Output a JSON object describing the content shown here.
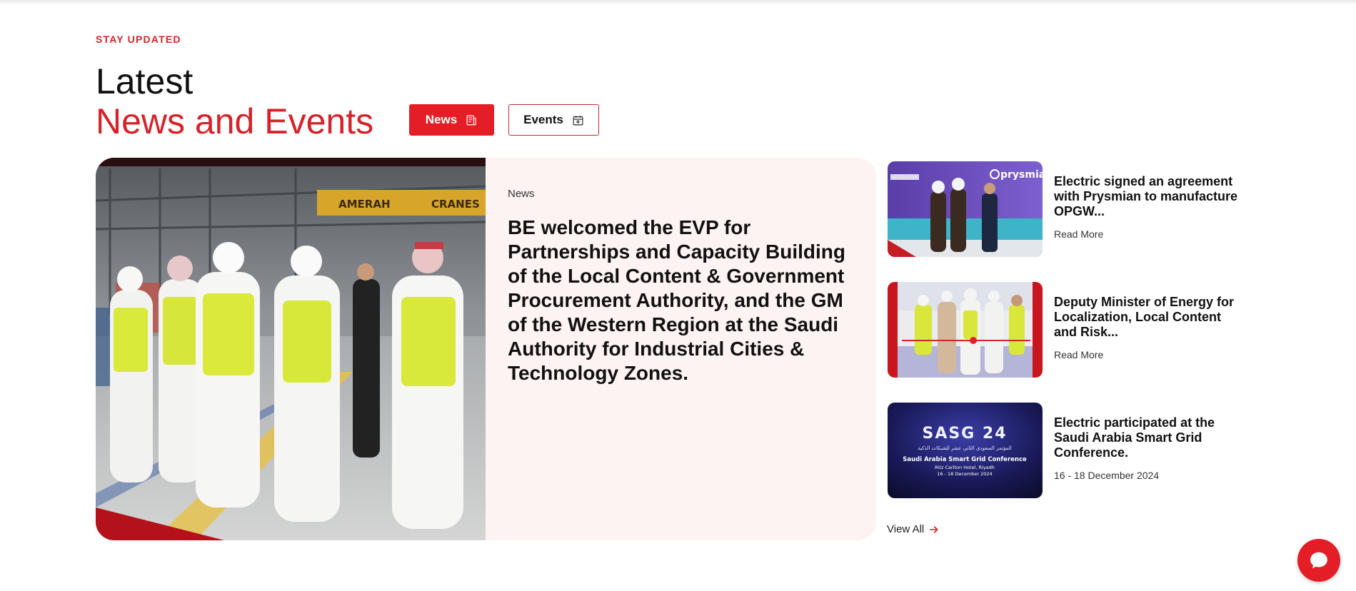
{
  "section": {
    "eyebrow": "STAY UPDATED",
    "title_line1": "Latest",
    "title_line2": "News and Events"
  },
  "tabs": [
    {
      "label": "News",
      "icon": "news-icon",
      "active": true
    },
    {
      "label": "Events",
      "icon": "calendar-icon",
      "active": false
    }
  ],
  "featured": {
    "category": "News",
    "headline": "BE welcomed the EVP for Partnerships and Capacity Building of the Local Content & Government Procurement Authority, and the GM of the Western Region at the Saudi Authority for Industrial Cities & Technology Zones.",
    "image_sign_left": "AMERAH",
    "image_sign_right": "CRANES"
  },
  "side_items": [
    {
      "title": "Electric signed an agreement with Prysmian to manufacture OPGW...",
      "meta": "Read More",
      "thumb_text": "prysmian"
    },
    {
      "title": "Deputy Minister of Energy for Localization, Local Content and Risk...",
      "meta": "Read More"
    },
    {
      "title": "Electric participated at the Saudi Arabia Smart Grid Conference.",
      "meta": "16 - 18 December 2024",
      "thumb_lines": [
        "SASG 24",
        "المؤتمر السعودي الثاني عشر للشبكات الذكية",
        "Saudi Arabia Smart Grid Conference",
        "Ritz Carlton Hotel, Riyadh",
        "16 - 18 December 2024"
      ]
    }
  ],
  "view_all": "View All",
  "colors": {
    "accent": "#e31e26",
    "feature_bg": "#fdf3f2"
  }
}
